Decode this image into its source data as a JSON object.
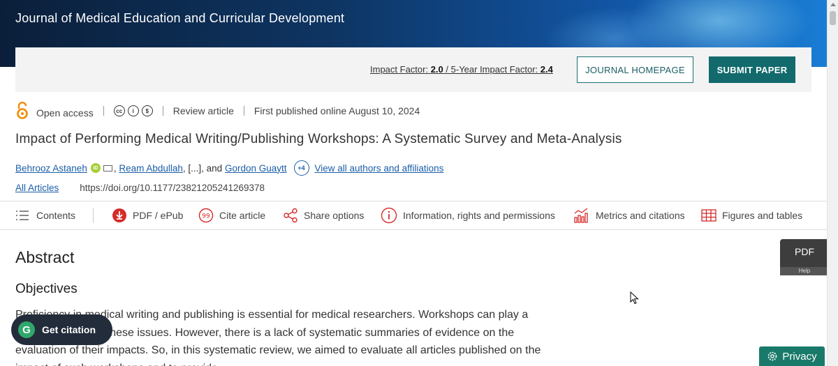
{
  "header": {
    "journal_title": "Journal of Medical Education and Curricular Development"
  },
  "impact": {
    "impact_label": "Impact Factor:",
    "impact_value": "2.0",
    "five_year_label": "/ 5-Year Impact Factor:",
    "five_year_value": "2.4",
    "homepage_button": "JOURNAL HOMEPAGE",
    "submit_button": "SUBMIT PAPER"
  },
  "meta": {
    "access": "Open access",
    "article_type": "Review article",
    "published": "First published online August 10, 2024"
  },
  "article": {
    "title": "Impact of Performing Medical Writing/Publishing Workshops: A Systematic Survey and Meta-Analysis",
    "author1": "Behrooz Astaneh",
    "author2": "Ream Abdullah",
    "ellipsis": ", [...], and ",
    "author3": "Gordon Guaytt",
    "more_count": "+4",
    "view_all": "View all authors and affiliations",
    "all_articles": "All Articles",
    "doi": "https://doi.org/10.1177/23821205241269378"
  },
  "toolbar": {
    "contents": "Contents",
    "pdf": "PDF / ePub",
    "cite": "Cite article",
    "share": "Share options",
    "info": "Information, rights and permissions",
    "metrics": "Metrics and citations",
    "figures": "Figures and tables"
  },
  "body": {
    "abstract_heading": "Abstract",
    "objectives_heading": "Objectives",
    "paragraph": "Proficiency in medical writing and publishing is essential for medical researchers. Workshops can play a role in addressing these issues. However, there is a lack of systematic summaries of evidence on the evaluation of their impacts. So, in this systematic review, we aimed to evaluate all articles published on the impact of such workshops and to provide"
  },
  "floating": {
    "get_citation": "Get citation",
    "pdf_tab": "PDF",
    "help": "Help",
    "privacy": "Privacy"
  },
  "colors": {
    "accent": "#126a6c",
    "link": "#1a5ea8",
    "open_access": "#f28c00",
    "pdf_red": "#d72a2a"
  }
}
